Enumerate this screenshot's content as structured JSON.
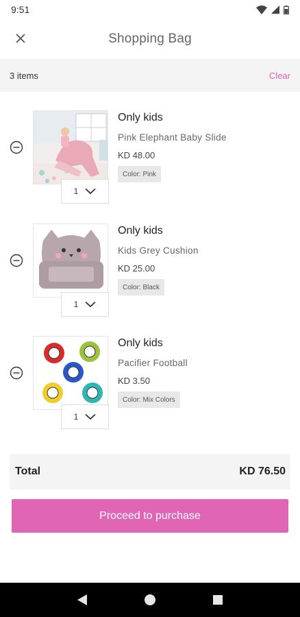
{
  "status_bar": {
    "time": "9:51"
  },
  "header": {
    "title": "Shopping Bag",
    "close_icon": "close-icon"
  },
  "items_bar": {
    "count": "3 items",
    "clear": "Clear"
  },
  "items": [
    {
      "brand": "Only kids",
      "name": "Pink Elephant Baby Slide",
      "price": "KD 48.00",
      "color": "Color: Pink",
      "qty": "1"
    },
    {
      "brand": "Only kids",
      "name": "Kids Grey Cushion",
      "price": "KD 25.00",
      "color": "Color: Black",
      "qty": "1"
    },
    {
      "brand": "Only kids",
      "name": "Pacifier Football",
      "price": "KD 3.50",
      "color": "Color: Mix Colors",
      "qty": "1"
    }
  ],
  "total": {
    "label": "Total",
    "value": "KD 76.50"
  },
  "purchase_button": {
    "label": "Proceed to purchase",
    "color": "#e066b5"
  },
  "accent_color": "#e05fb4"
}
